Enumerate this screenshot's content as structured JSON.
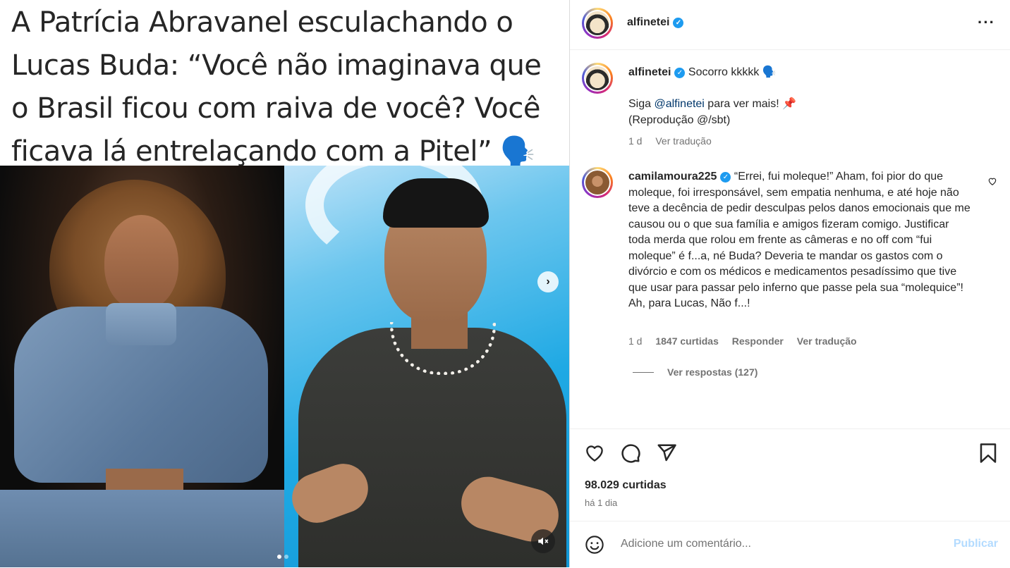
{
  "media": {
    "caption": "A Patrícia Abravanel esculachando o Lucas Buda: “Você não imaginava que o Brasil ficou com raiva de você? Você ficava lá entrelaçando com a Pitel” 🗣️",
    "next_glyph": "›"
  },
  "post": {
    "header": {
      "username": "alfinetei",
      "more_glyph": "···"
    },
    "caption": {
      "username": "alfinetei",
      "text_1": "Socorro kkkkk 🗣️",
      "line_2_prefix": "Siga ",
      "mention": "@alfinetei",
      "line_2_suffix": " para ver mais! 📌",
      "line_3": "(Reprodução @/sbt)",
      "age": "1 d",
      "translate": "Ver tradução"
    },
    "comment": {
      "username": "camilamoura225",
      "text": "“Errei, fui moleque!” Aham, foi pior do que moleque, foi irresponsável, sem empatia nenhuma, e até hoje não teve a decência de pedir desculpas pelos danos emocionais que me causou ou o que sua família e amigos fizeram comigo. Justificar toda merda que rolou em frente as câmeras e no off com “fui moleque” é f...a, né Buda? Deveria te mandar os gastos com o divórcio e com os médicos e medicamentos pesadíssimo que tive que usar para passar pelo inferno que passe pela sua “molequice”! Ah, para Lucas, Não f...!",
      "age": "1 d",
      "likes": "1847 curtidas",
      "reply": "Responder",
      "translate": "Ver tradução",
      "view_replies": "Ver respostas (127)"
    },
    "likes": "98.029 curtidas",
    "time_ago": "há 1 dia",
    "comment_input": {
      "placeholder": "Adicione um comentário..."
    },
    "post_button": "Publicar"
  },
  "icons": {
    "verified": "verified-badge-icon",
    "heart": "heart-icon",
    "comment": "comment-icon",
    "share": "share-icon",
    "save": "bookmark-icon",
    "emoji": "emoji-icon",
    "mute": "muted-speaker-icon"
  },
  "colors": {
    "verified": "#1d9bf0",
    "post_disabled": "#b3dbff",
    "link": "#00376b",
    "muted": "#737373"
  }
}
